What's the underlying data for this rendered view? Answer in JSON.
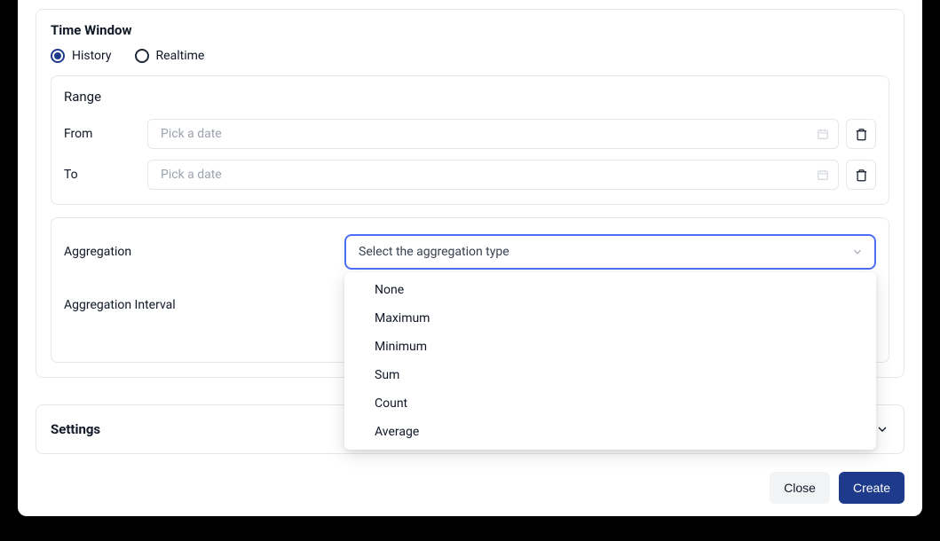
{
  "timeWindow": {
    "title": "Time Window",
    "radios": {
      "history": "History",
      "realtime": "Realtime"
    },
    "range": {
      "title": "Range",
      "from_label": "From",
      "to_label": "To",
      "from_placeholder": "Pick a date",
      "to_placeholder": "Pick a date"
    },
    "aggregation": {
      "label": "Aggregation",
      "placeholder": "Select the aggregation type",
      "interval_label": "Aggregation Interval",
      "options": [
        "None",
        "Maximum",
        "Minimum",
        "Sum",
        "Count",
        "Average"
      ]
    }
  },
  "settings": {
    "title": "Settings"
  },
  "footer": {
    "close": "Close",
    "create": "Create"
  }
}
